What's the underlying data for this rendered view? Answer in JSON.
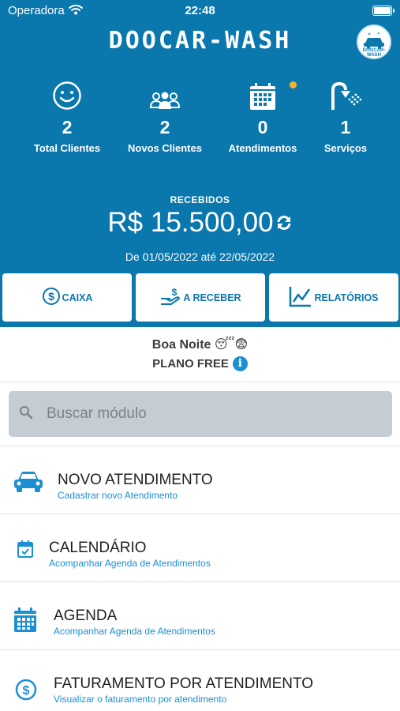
{
  "status_bar": {
    "carrier": "Operadora",
    "time": "22:48"
  },
  "header": {
    "brand": "DOOCAR-WASH",
    "logo_text": "DOOCAR-WASH",
    "stats": [
      {
        "icon": "smiley-icon",
        "value": "2",
        "label": "Total Clientes"
      },
      {
        "icon": "users-group-icon",
        "value": "2",
        "label": "Novos Clientes"
      },
      {
        "icon": "calendar-grid-icon",
        "value": "0",
        "label": "Atendimentos"
      },
      {
        "icon": "shower-icon",
        "value": "1",
        "label": "Serviços"
      }
    ],
    "received_label": "RECEBIDOS",
    "received_amount": "R$ 15.500,00",
    "period": "De 01/05/2022 até 22/05/2022"
  },
  "actions": [
    {
      "icon": "dollar-circle-icon",
      "label": "CAIXA"
    },
    {
      "icon": "hand-money-icon",
      "label": "A RECEBER"
    },
    {
      "icon": "line-chart-icon",
      "label": "RELATÓRIOS"
    }
  ],
  "greeting": "Boa Noite 😴😨",
  "plan": "PLANO FREE",
  "search": {
    "placeholder": "Buscar módulo"
  },
  "modules": [
    {
      "icon": "car-icon",
      "title": "NOVO ATENDIMENTO",
      "subtitle": "Cadastrar novo Atendimento"
    },
    {
      "icon": "calendar-check-icon",
      "title": "CALENDÁRIO",
      "subtitle": "Acompanhar Agenda de Atendimentos"
    },
    {
      "icon": "calendar-grid-icon",
      "title": "AGENDA",
      "subtitle": "Acompanhar Agenda de Atendimentos"
    },
    {
      "icon": "dollar-circle-icon",
      "title": "FATURAMENTO POR ATENDIMENTO",
      "subtitle": "Visualizar o faturamento por atendimento"
    }
  ],
  "colors": {
    "primary": "#0a77ad",
    "accent": "#1a8fd4",
    "badge": "#f3b42a",
    "search_bg": "#c5ccd3"
  }
}
